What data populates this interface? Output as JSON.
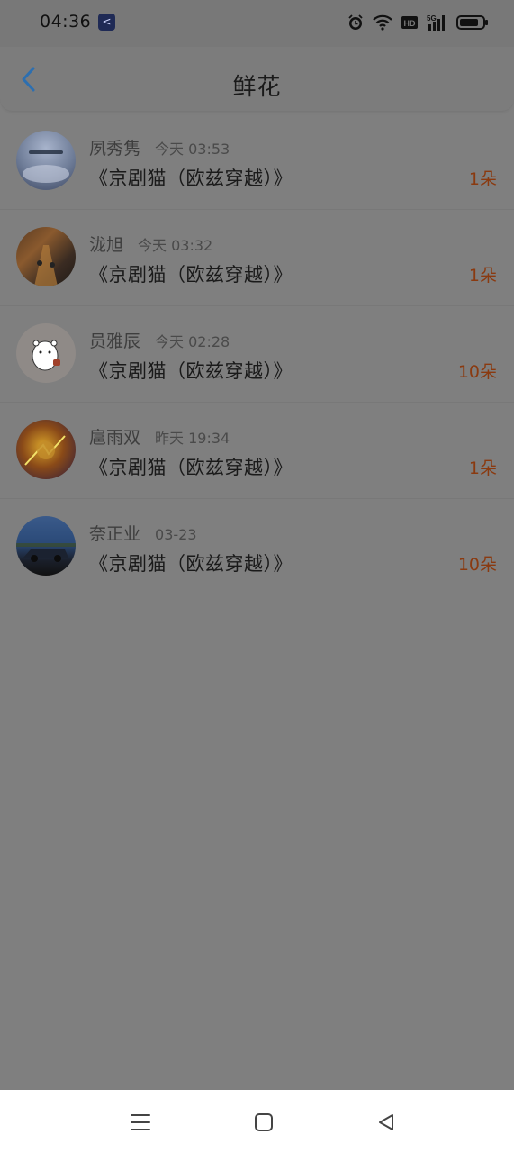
{
  "status_bar": {
    "time": "04:36",
    "app_icon": "kuaishou-icon",
    "icons": [
      "alarm-icon",
      "wifi-icon",
      "hd-icon",
      "5g-signal-icon",
      "battery-icon"
    ]
  },
  "header": {
    "title": "鲜花",
    "back_icon": "chevron-left-icon"
  },
  "records": [
    {
      "name": "夙秀隽",
      "time": "今天 03:53",
      "book": "《京剧猫（欧兹穿越）》",
      "count": "1朵"
    },
    {
      "name": "泷旭",
      "time": "今天 03:32",
      "book": "《京剧猫（欧兹穿越）》",
      "count": "1朵"
    },
    {
      "name": "员雅辰",
      "time": "今天 02:28",
      "book": "《京剧猫（欧兹穿越）》",
      "count": "10朵"
    },
    {
      "name": "扈雨双",
      "time": "昨天 19:34",
      "book": "《京剧猫（欧兹穿越）》",
      "count": "1朵"
    },
    {
      "name": "奈正业",
      "time": "03-23",
      "book": "《京剧猫（欧兹穿越）》",
      "count": "10朵"
    }
  ],
  "nav_bar": {
    "icons": [
      "menu-icon",
      "home-icon",
      "back-icon"
    ]
  },
  "colors": {
    "accent": "#2d6fb0",
    "count": "#8a3a10",
    "overlay": "#7f7f7f"
  }
}
